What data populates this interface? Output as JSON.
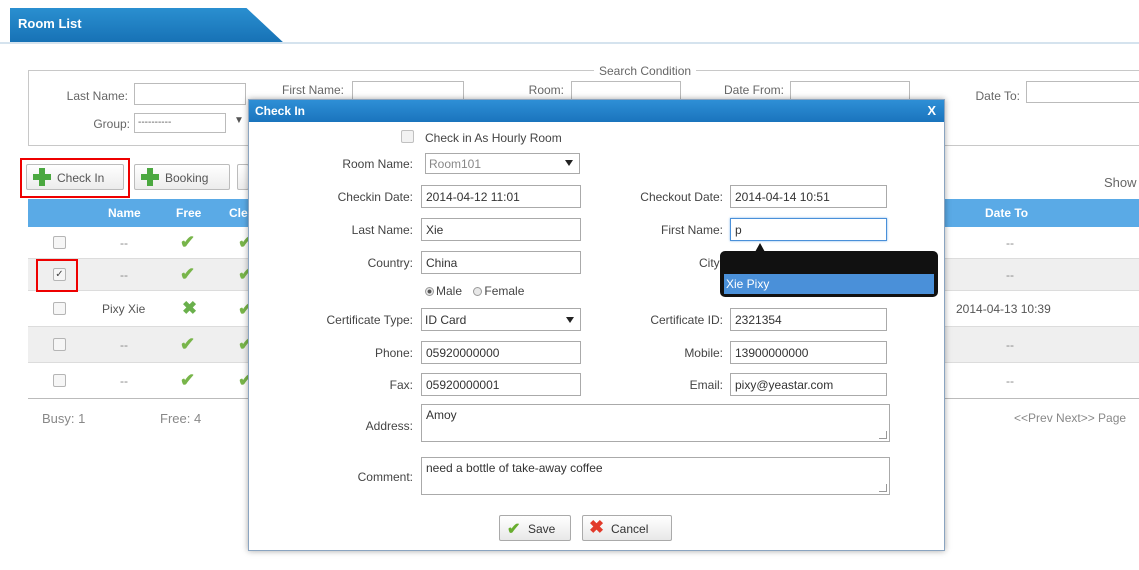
{
  "tab": {
    "title": "Room List"
  },
  "search": {
    "legend": "Search Condition",
    "last_name_label": "Last Name:",
    "first_name_label": "First Name:",
    "room_label": "Room:",
    "date_from_label": "Date From:",
    "date_to_label": "Date To:",
    "group_label": "Group:",
    "group_value": "----------"
  },
  "toolbar": {
    "checkin_label": "Check In",
    "booking_label": "Booking",
    "show_label": "Show"
  },
  "table": {
    "headers": {
      "name": "Name",
      "free": "Free",
      "clean": "Cle",
      "date_to": "Date To"
    },
    "rows": [
      {
        "checked": "",
        "name": "--",
        "date_to": "--"
      },
      {
        "checked": "✓",
        "name": "--",
        "date_to": "--"
      },
      {
        "checked": "",
        "name": "Pixy Xie",
        "date_to": "2014-04-13 10:39"
      },
      {
        "checked": "",
        "name": "--",
        "date_to": "--"
      },
      {
        "checked": "",
        "name": "--",
        "date_to": "--"
      }
    ]
  },
  "footer": {
    "busy": "Busy: 1",
    "free": "Free: 4",
    "pager": "<<Prev Next>> Page"
  },
  "modal": {
    "title": "Check In",
    "close": "X",
    "hourly_label": "Check in As Hourly Room",
    "room_name_label": "Room Name:",
    "room_name_value": "Room101",
    "checkin_date_label": "Checkin Date:",
    "checkin_date_value": "2014-04-12 11:01",
    "checkout_date_label": "Checkout Date:",
    "checkout_date_value": "2014-04-14 10:51",
    "last_name_label": "Last Name:",
    "last_name_value": "Xie",
    "first_name_label": "First Name:",
    "first_name_value": "p",
    "country_label": "Country:",
    "country_value": "China",
    "city_label": "City:",
    "male_label": "Male",
    "female_label": "Female",
    "cert_type_label": "Certificate Type:",
    "cert_type_value": "ID Card",
    "cert_id_label": "Certificate ID:",
    "cert_id_value": "2321354",
    "phone_label": "Phone:",
    "phone_value": "05920000000",
    "mobile_label": "Mobile:",
    "mobile_value": "13900000000",
    "fax_label": "Fax:",
    "fax_value": "05920000001",
    "email_label": "Email:",
    "email_value": "pixy@yeastar.com",
    "address_label": "Address:",
    "address_value": "Amoy",
    "comment_label": "Comment:",
    "comment_value": "need a bottle of take-away coffee",
    "save_label": "Save",
    "cancel_label": "Cancel"
  },
  "autocomplete": {
    "suggestion": "Xie Pixy"
  }
}
